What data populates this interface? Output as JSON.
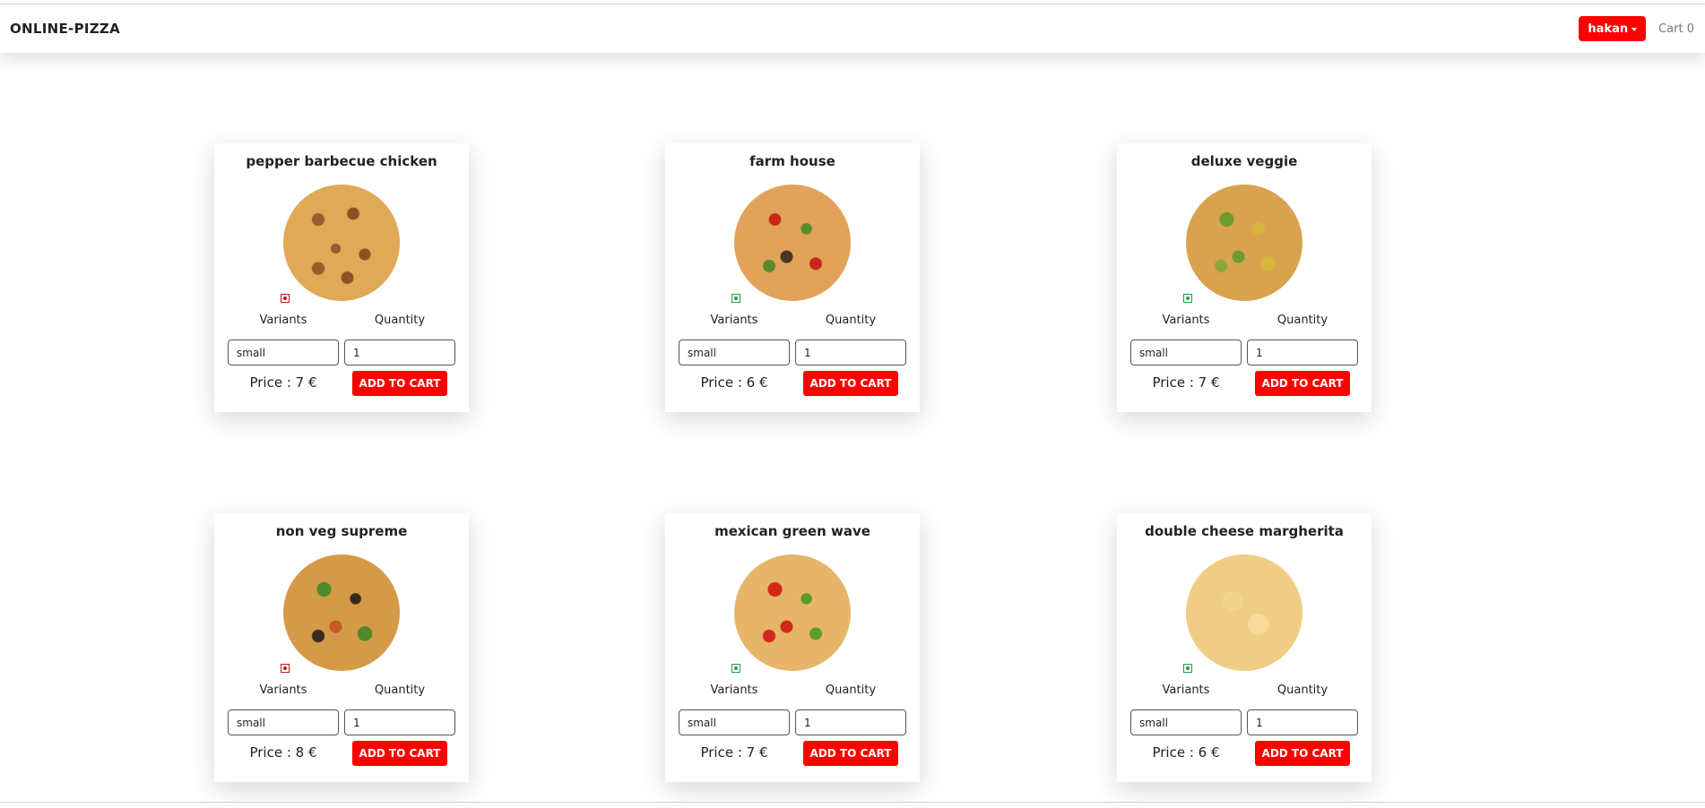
{
  "navbar": {
    "brand": "ONLINE-PIZZA",
    "user_label": "hakan",
    "cart_label": "Cart 0"
  },
  "colors": {
    "accent": "#ff0000",
    "veg": "#1e9f4a",
    "non_veg": "#b01c1c"
  },
  "labels": {
    "variants": "Variants",
    "quantity": "Quantity",
    "add_to_cart": "ADD TO CART"
  },
  "pizzas": [
    {
      "name": "pepper barbecue chicken",
      "type": "non-veg",
      "variant": "small",
      "quantity": "1",
      "price": "Price : 7 €"
    },
    {
      "name": "farm house",
      "type": "veg",
      "variant": "small",
      "quantity": "1",
      "price": "Price : 6 €"
    },
    {
      "name": "deluxe veggie",
      "type": "veg",
      "variant": "small",
      "quantity": "1",
      "price": "Price : 7 €"
    },
    {
      "name": "non veg supreme",
      "type": "non-veg",
      "variant": "small",
      "quantity": "1",
      "price": "Price : 8 €"
    },
    {
      "name": "mexican green wave",
      "type": "veg",
      "variant": "small",
      "quantity": "1",
      "price": "Price : 7 €"
    },
    {
      "name": "double cheese margherita",
      "type": "veg",
      "variant": "small",
      "quantity": "1",
      "price": "Price : 6 €"
    }
  ]
}
